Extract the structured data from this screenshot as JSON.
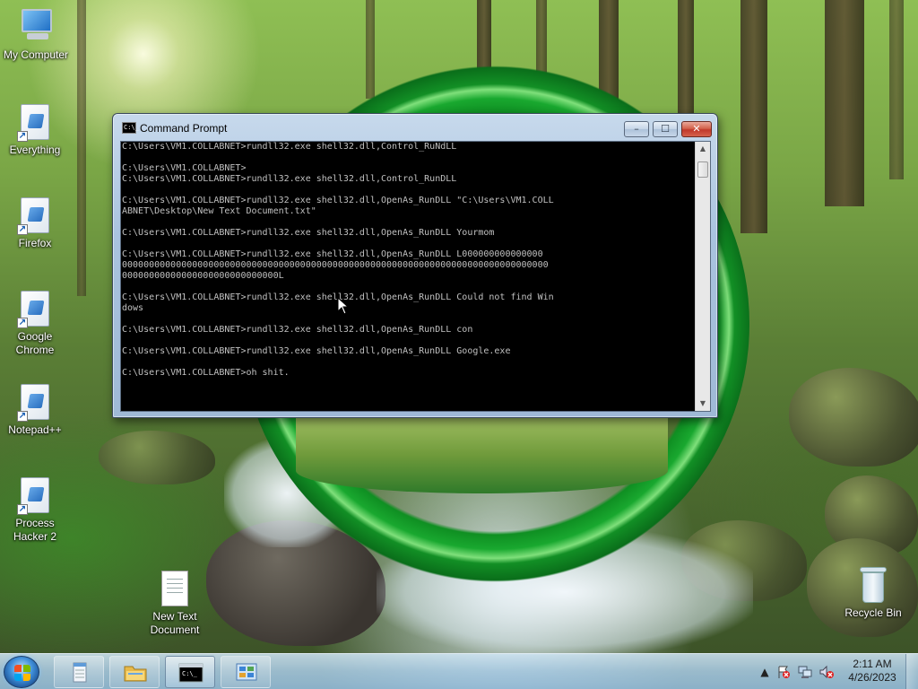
{
  "desktop": {
    "icons": [
      {
        "label": "My Computer",
        "kind": "computer"
      },
      {
        "label": "Everything",
        "kind": "app-shortcut"
      },
      {
        "label": "Firefox",
        "kind": "app-shortcut"
      },
      {
        "label": "Google Chrome",
        "kind": "app-shortcut"
      },
      {
        "label": "Notepad++",
        "kind": "app-shortcut"
      },
      {
        "label": "Process Hacker 2",
        "kind": "app-shortcut"
      },
      {
        "label": "New Text Document",
        "kind": "text-file"
      },
      {
        "label": "Recycle Bin",
        "kind": "recycle-bin"
      }
    ],
    "wallpaper": "forest-with-stream-and-green-ring"
  },
  "cmd_window": {
    "title": "Command Prompt",
    "icon_text": "C:\\_",
    "buttons": {
      "minimize": "–",
      "maximize": "☐",
      "close": "✕"
    },
    "text_color": "#c0c0c0",
    "background_color": "#000000",
    "lines": [
      "C:\\Users\\VM1.COLLABNET>rundll32.exe shell32.dll,Control_RuNdLL",
      "",
      "C:\\Users\\VM1.COLLABNET>",
      "C:\\Users\\VM1.COLLABNET>rundll32.exe shell32.dll,Control_RunDLL",
      "",
      "C:\\Users\\VM1.COLLABNET>rundll32.exe shell32.dll,OpenAs_RunDLL \"C:\\Users\\VM1.COLL",
      "ABNET\\Desktop\\New Text Document.txt\"",
      "",
      "C:\\Users\\VM1.COLLABNET>rundll32.exe shell32.dll,OpenAs_RunDLL Yourmom",
      "",
      "C:\\Users\\VM1.COLLABNET>rundll32.exe shell32.dll,OpenAs_RunDLL L000000000000000",
      "0000000000000000000000000000000000000000000000000000000000000000000000000000000",
      "00000000000000000000000000000L",
      "",
      "C:\\Users\\VM1.COLLABNET>rundll32.exe shell32.dll,OpenAs_RunDLL Could not find Win",
      "dows",
      "",
      "C:\\Users\\VM1.COLLABNET>rundll32.exe shell32.dll,OpenAs_RunDLL con",
      "",
      "C:\\Users\\VM1.COLLABNET>rundll32.exe shell32.dll,OpenAs_RunDLL Google.exe",
      "",
      "C:\\Users\\VM1.COLLABNET>oh shit."
    ],
    "scroll": {
      "up": "▲",
      "down": "▼"
    }
  },
  "taskbar": {
    "start_label": "Start",
    "pinned": [
      {
        "name": "notepad",
        "icon": "notepad-icon"
      },
      {
        "name": "explorer",
        "icon": "folder-icon"
      },
      {
        "name": "command-prompt",
        "icon": "cmd-icon",
        "active": true
      },
      {
        "name": "control-panel",
        "icon": "control-panel-icon"
      }
    ],
    "tray": {
      "show_hidden": "▲",
      "icons": [
        "action-center-flag-icon",
        "network-icon",
        "volume-muted-icon"
      ]
    },
    "clock": {
      "time": "2:11 AM",
      "date": "4/26/2023"
    }
  },
  "colors": {
    "taskbar": "#a9cde8",
    "ring_green": "#19a82f",
    "close_button": "#c0392b"
  }
}
